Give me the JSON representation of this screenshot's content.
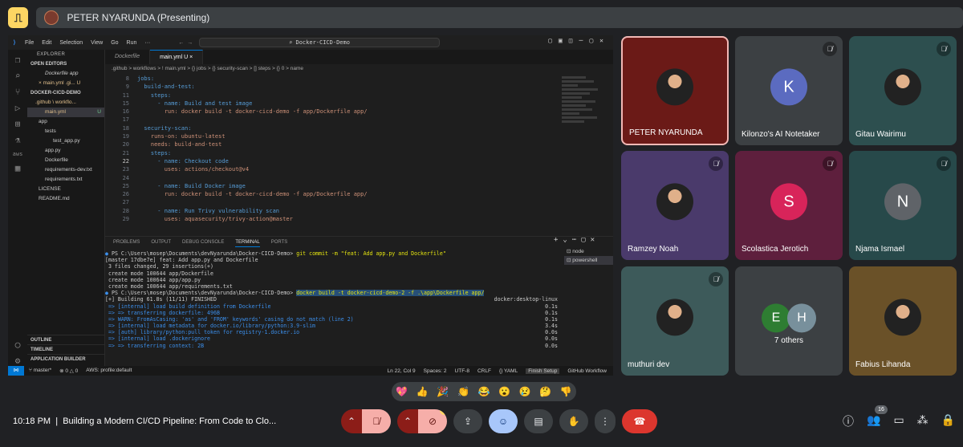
{
  "topbar": {
    "presenter_label": "PETER NYARUNDA (Presenting)"
  },
  "vscode": {
    "menu": [
      "File",
      "Edit",
      "Selection",
      "View",
      "Go",
      "Run",
      "···"
    ],
    "search": "Docker-CICD-Demo",
    "tabs": [
      {
        "label": "Dockerfile"
      },
      {
        "label": "main.yml U ×"
      }
    ],
    "breadcrumb": ".github > workflows > ! main.yml > {} jobs > {} security-scan > [] steps > {} 0 > name",
    "explorer": {
      "title": "EXPLORER",
      "open_editors": "OPEN EDITORS",
      "open1": "Dockerfile app",
      "open2": "× main.yml .gi... U",
      "project": "DOCKER-CICD-DEMO",
      "f1": ".github \\ workflo...",
      "f2": "main.yml",
      "f3": "app",
      "f4": "tests",
      "f5": "test_app.py",
      "f6": "app.py",
      "f7": "Dockerfile",
      "f8": "requirements-dev.txt",
      "f9": "requirements.txt",
      "f10": "LICENSE",
      "f11": "README.md",
      "outline": "OUTLINE",
      "timeline": "TIMELINE",
      "app_builder": "APPLICATION BUILDER"
    },
    "code": [
      {
        "n": "8",
        "t": "jobs:"
      },
      {
        "n": "9",
        "t": "  build-and-test:"
      },
      {
        "n": "11",
        "t": "    steps:"
      },
      {
        "n": "15",
        "t": "      - name: Build and test image"
      },
      {
        "n": "16",
        "t": "        run: docker build -t docker-cicd-demo -f app/Dockerfile app/"
      },
      {
        "n": "17",
        "t": ""
      },
      {
        "n": "18",
        "t": "  security-scan:"
      },
      {
        "n": "19",
        "t": "    runs-on: ubuntu-latest"
      },
      {
        "n": "20",
        "t": "    needs: build-and-test"
      },
      {
        "n": "21",
        "t": "    steps:"
      },
      {
        "n": "22",
        "t": "      - name: Checkout code"
      },
      {
        "n": "23",
        "t": "        uses: actions/checkout@v4"
      },
      {
        "n": "24",
        "t": ""
      },
      {
        "n": "25",
        "t": "      - name: Build Docker image"
      },
      {
        "n": "26",
        "t": "        run: docker build -t docker-cicd-demo -f app/Dockerfile app/"
      },
      {
        "n": "27",
        "t": ""
      },
      {
        "n": "28",
        "t": "      - name: Run Trivy vulnerability scan"
      },
      {
        "n": "29",
        "t": "        uses: aquasecurity/trivy-action@master"
      }
    ],
    "panel_tabs": [
      "PROBLEMS",
      "OUTPUT",
      "DEBUG CONSOLE",
      "TERMINAL",
      "PORTS"
    ],
    "terminal": {
      "l1_prompt": "PS C:\\Users\\mosep\\Documents\\devNyarunda\\Docker-CICD-Demo> ",
      "l1_cmd": "git commit -m \"feat: Add app.py and Dockerfile\"",
      "l2": "[master 17dbe7e] feat: Add app.py and Dockerfile",
      "l3": " 3 files changed, 29 insertions(+)",
      "l4": " create mode 100644 app/Dockerfile",
      "l5": " create mode 100644 app/app.py",
      "l6": " create mode 100644 app/requirements.txt",
      "l7_prompt": "PS C:\\Users\\mosep\\Documents\\devNyarunda\\Docker-CICD-Demo> ",
      "l7_cmd": "docker build -t docker-cicd-demo-2 -f .\\app\\Dockerfile app/",
      "l8": "[+] Building 61.8s (11/11) FINISHED",
      "l8r": "docker:desktop-linux",
      "l9": " => [internal] load build definition from Dockerfile",
      "l9r": "0.1s",
      "l10": " => => transferring dockerfile: 496B",
      "l10r": "0.1s",
      "l11": " => WARN: FromAsCasing: 'as' and 'FROM' keywords' casing do not match (line 2)",
      "l11r": "0.1s",
      "l12": " => [internal] load metadata for docker.io/library/python:3.9-slim",
      "l12r": "3.4s",
      "l13": " => [auth] library/python:pull token for registry-1.docker.io",
      "l13r": "0.0s",
      "l14": " => [internal] load .dockerignore",
      "l14r": "0.0s",
      "l15": " => => transferring context: 2B",
      "l15r": "0.0s"
    },
    "terminals": [
      "node",
      "powershell"
    ],
    "status": {
      "branch": "master*",
      "sync": "⊗ 0 △ 0",
      "aws": "AWS: profile:default",
      "pos": "Ln 22, Col 9",
      "spaces": "Spaces: 2",
      "enc": "UTF-8",
      "eol": "CRLF",
      "lang": "{} YAML",
      "finish": "Finish Setup",
      "workflow": "GitHub Workflow"
    }
  },
  "participants": [
    {
      "name": "PETER NYARUNDA",
      "initial": "",
      "color": "#6b1a17"
    },
    {
      "name": "Kilonzo's AI Notetaker",
      "initial": "K",
      "color": "#3c4043"
    },
    {
      "name": "Gitau Wairimu",
      "initial": "",
      "color": "#2d4f4f"
    },
    {
      "name": "Ramzey Noah",
      "initial": "",
      "color": "#4a3a6b"
    },
    {
      "name": "Scolastica Jerotich",
      "initial": "S",
      "color": "#5e1f3d"
    },
    {
      "name": "Njama Ismael",
      "initial": "N",
      "color": "#27494a"
    },
    {
      "name": "muthuri dev",
      "initial": "",
      "color": "#3d5a5a"
    },
    {
      "name": "7 others",
      "initial": "",
      "color": "#3c4043"
    },
    {
      "name": "Fabius Lihanda",
      "initial": "",
      "color": "#6a5128"
    }
  ],
  "others": {
    "a": "E",
    "b": "H"
  },
  "reactions": [
    "💖",
    "👍",
    "🎉",
    "👏",
    "😂",
    "😮",
    "😢",
    "🤔",
    "👎"
  ],
  "bottom": {
    "time": "10:18 PM",
    "separator": "|",
    "meeting_title": "Building a Modern CI/CD Pipeline: From Code to Clo...",
    "people_count": "16"
  }
}
